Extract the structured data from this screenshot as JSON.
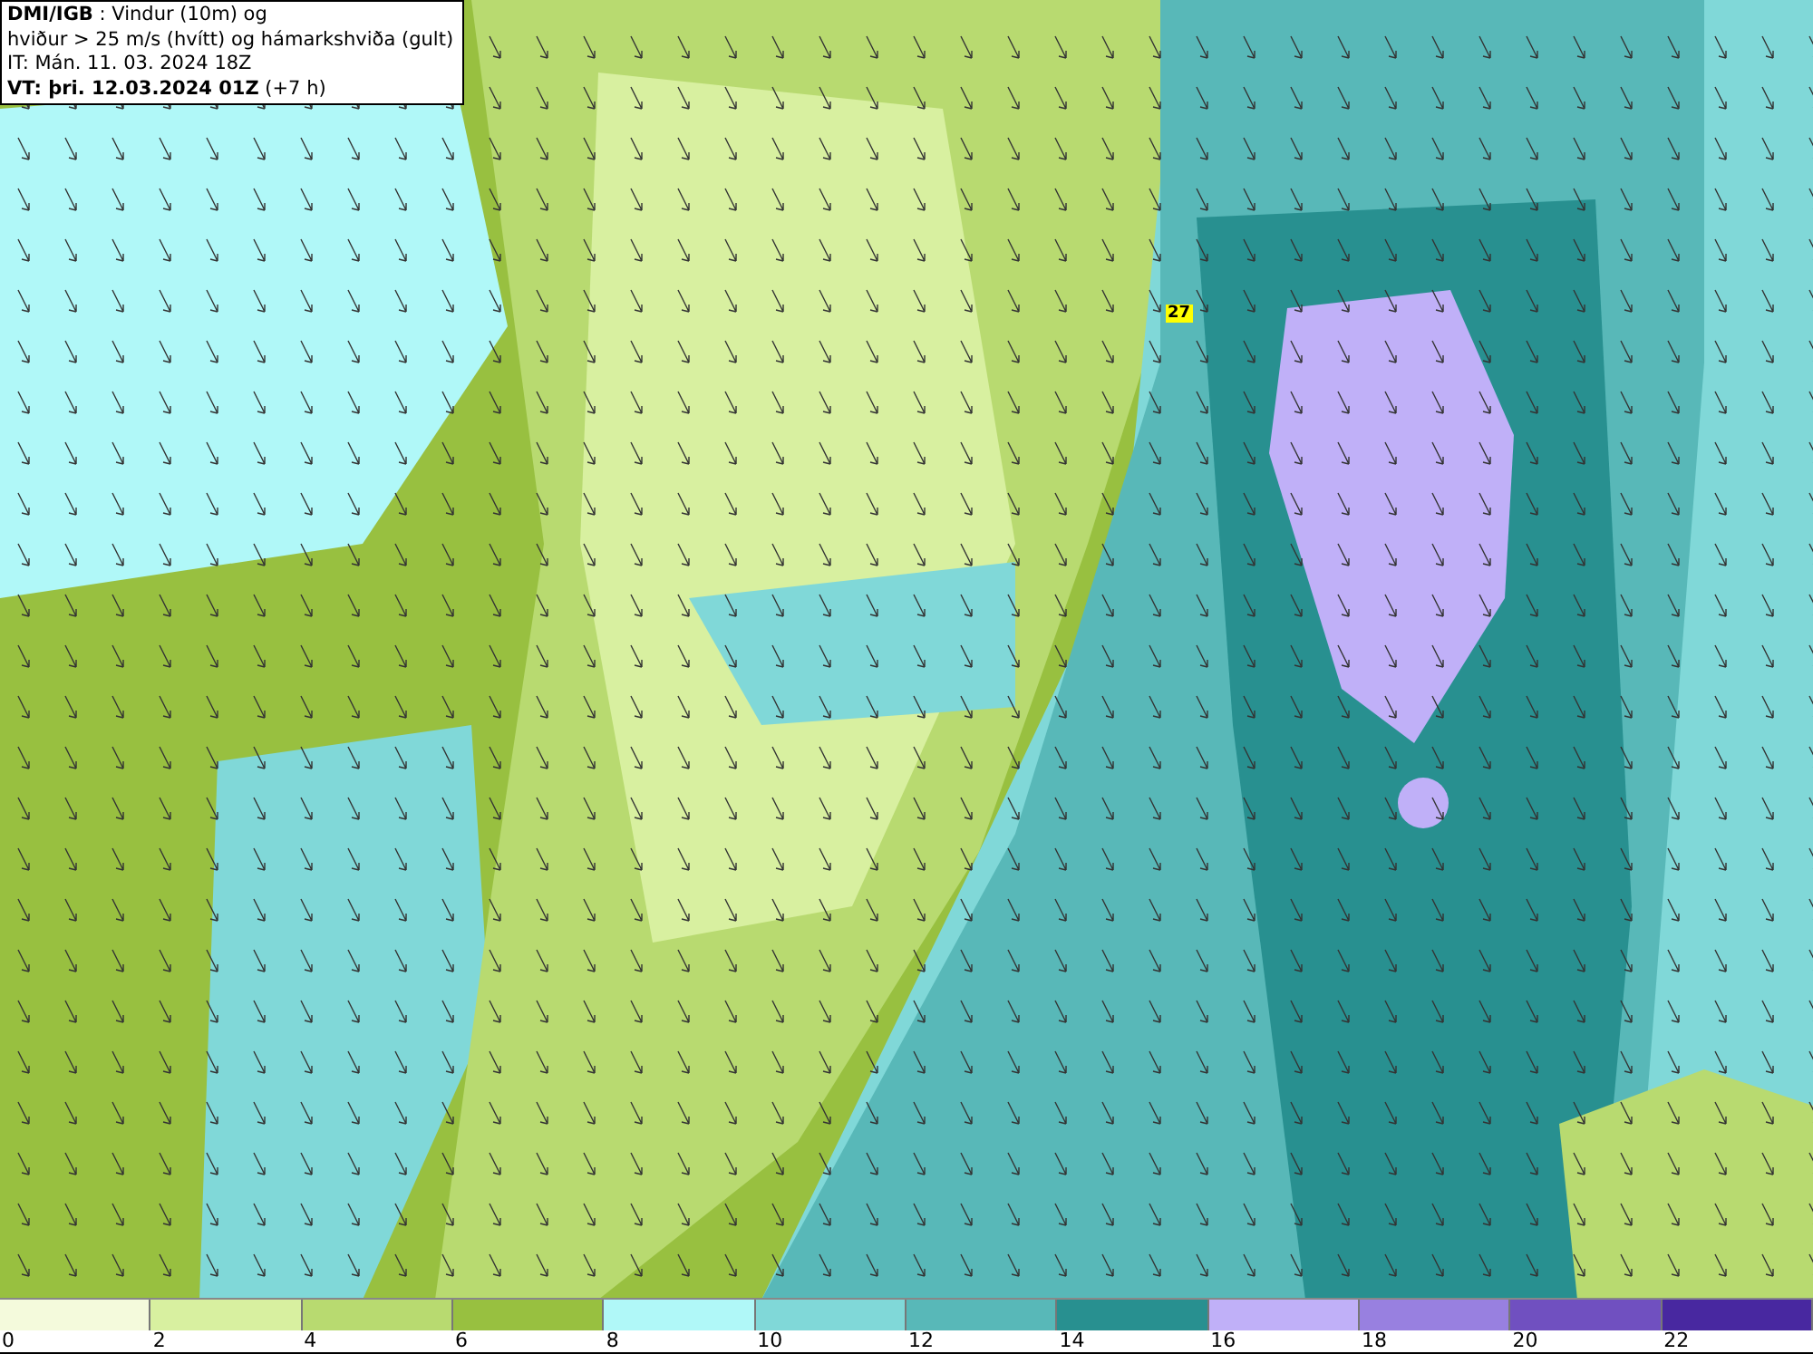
{
  "info_box": {
    "source": "DMI/IGB",
    "title_rest": " : Vindur (10m) og",
    "line_2": "hviður > 25 m/s (hvítt) og hámarkshviða (gult)",
    "issue_time": "IT: Mán. 11. 03. 2024 18Z",
    "valid_label": "VT: þri. 12.03.2024 01Z",
    "valid_offset": " (+7 h)"
  },
  "map": {
    "gust_labels": [
      "27"
    ]
  },
  "legend": [
    {
      "label": "0",
      "color": "#f4fadc"
    },
    {
      "label": "2",
      "color": "#d8f0a0"
    },
    {
      "label": "4",
      "color": "#b8da70"
    },
    {
      "label": "6",
      "color": "#98c040"
    },
    {
      "label": "8",
      "color": "#b0f8f8"
    },
    {
      "label": "10",
      "color": "#80d8d8"
    },
    {
      "label": "12",
      "color": "#58b8b8"
    },
    {
      "label": "14",
      "color": "#289090"
    },
    {
      "label": "16",
      "color": "#c0b0f8"
    },
    {
      "label": "18",
      "color": "#9880e0"
    },
    {
      "label": "20",
      "color": "#7050c0"
    },
    {
      "label": "22",
      "color": "#4828a0"
    }
  ]
}
